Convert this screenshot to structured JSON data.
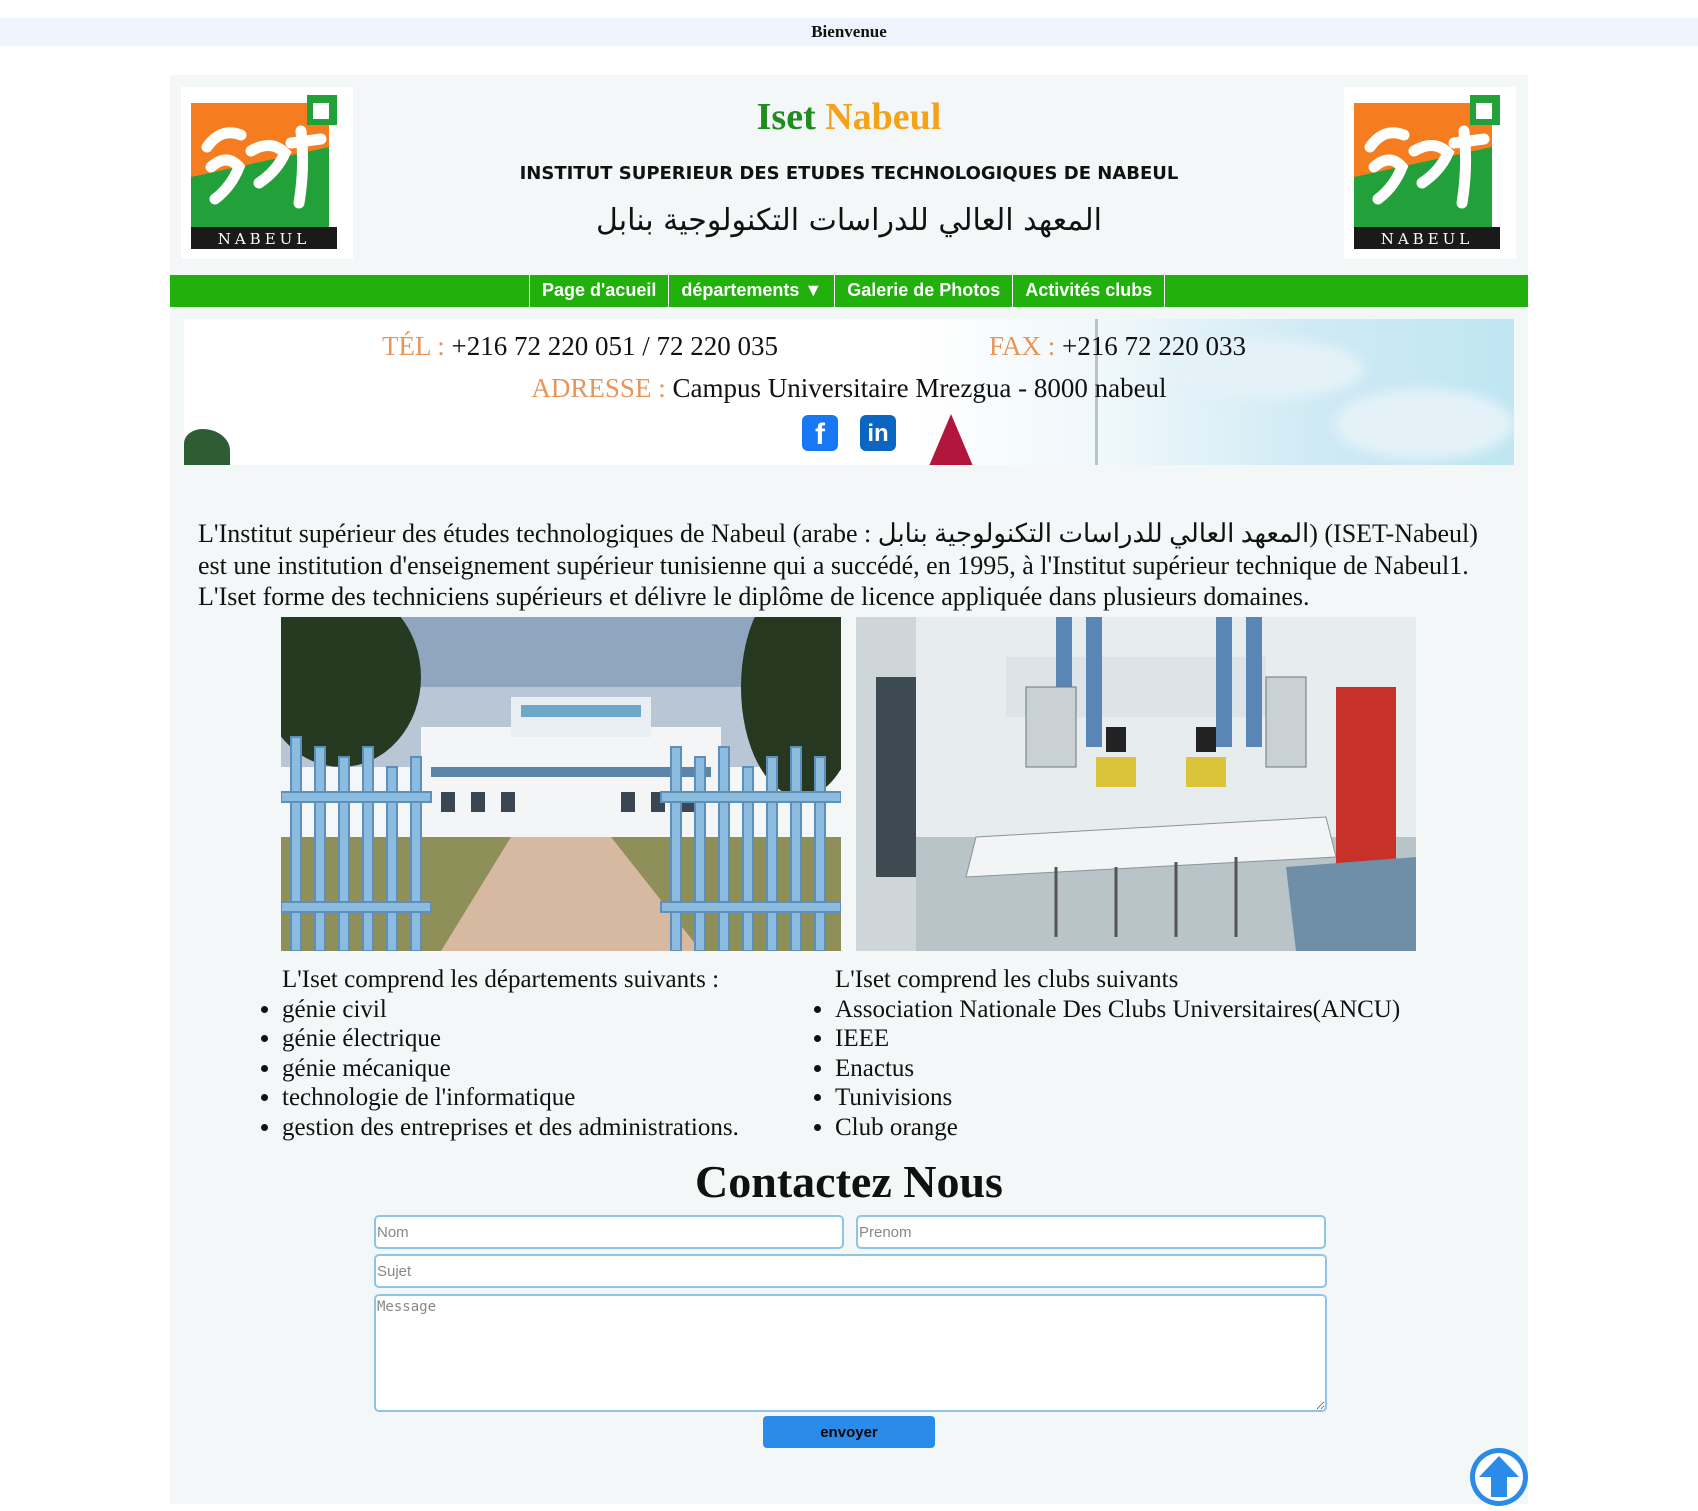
{
  "topbar": {
    "text": "Bienvenue"
  },
  "header": {
    "title_part1": "Iset",
    "title_part2": "Nabeul",
    "full_name_fr": "INSTITUT SUPERIEUR DES ETUDES TECHNOLOGIQUES DE NABEUL",
    "full_name_ar": "المعهد العالي للدراسات التكنولوجية بنابل",
    "logo_text": "NABEUL",
    "logo_icon": "iset-logo"
  },
  "nav": {
    "items": [
      {
        "label": "Page d'acueil"
      },
      {
        "label": "départements ▼"
      },
      {
        "label": "Galerie de Photos"
      },
      {
        "label": "Activités clubs"
      }
    ]
  },
  "contact_info": {
    "tel_label": "TÉL :",
    "tel_value": "+216 72 220 051 / 72 220 035",
    "fax_label": "FAX :",
    "fax_value": "+216 72 220 033",
    "address_label": "ADRESSE :",
    "address_value": "Campus Universitaire Mrezgua - 8000 nabeul",
    "social": [
      {
        "name": "facebook-icon",
        "glyph": "f"
      },
      {
        "name": "linkedin-icon",
        "glyph": "in"
      }
    ]
  },
  "intro": {
    "text": "L'Institut supérieur des études technologiques de Nabeul (arabe : المعهد العالي للدراسات التكنولوجية بنابل) (ISET-Nabeul) est une institution d'enseignement supérieur tunisienne qui a succédé, en 1995, à l'Institut supérieur technique de Nabeul1. L'Iset forme des techniciens supérieurs et délivre le diplôme de licence appliquée dans plusieurs domaines."
  },
  "departments": {
    "title": "L'Iset comprend les départements suivants :",
    "items": [
      "génie civil",
      "génie électrique",
      "génie mécanique",
      "technologie de l'informatique",
      "gestion des entreprises et des administrations."
    ]
  },
  "clubs": {
    "title": "L'Iset comprend les clubs suivants",
    "items": [
      "Association Nationale Des Clubs Universitaires(ANCU)",
      "IEEE",
      "Enactus",
      "Tunivisions",
      "Club orange"
    ]
  },
  "contact_form": {
    "title": "Contactez Nous",
    "nom_placeholder": "Nom",
    "prenom_placeholder": "Prenom",
    "sujet_placeholder": "Sujet",
    "message_placeholder": "Message",
    "submit_label": "envoyer"
  },
  "colors": {
    "nav_green": "#22b00c",
    "title_green": "#1e8c1e",
    "title_orange": "#f5a21b",
    "label_orange": "#e8955a",
    "button_blue": "#2b8bea"
  }
}
